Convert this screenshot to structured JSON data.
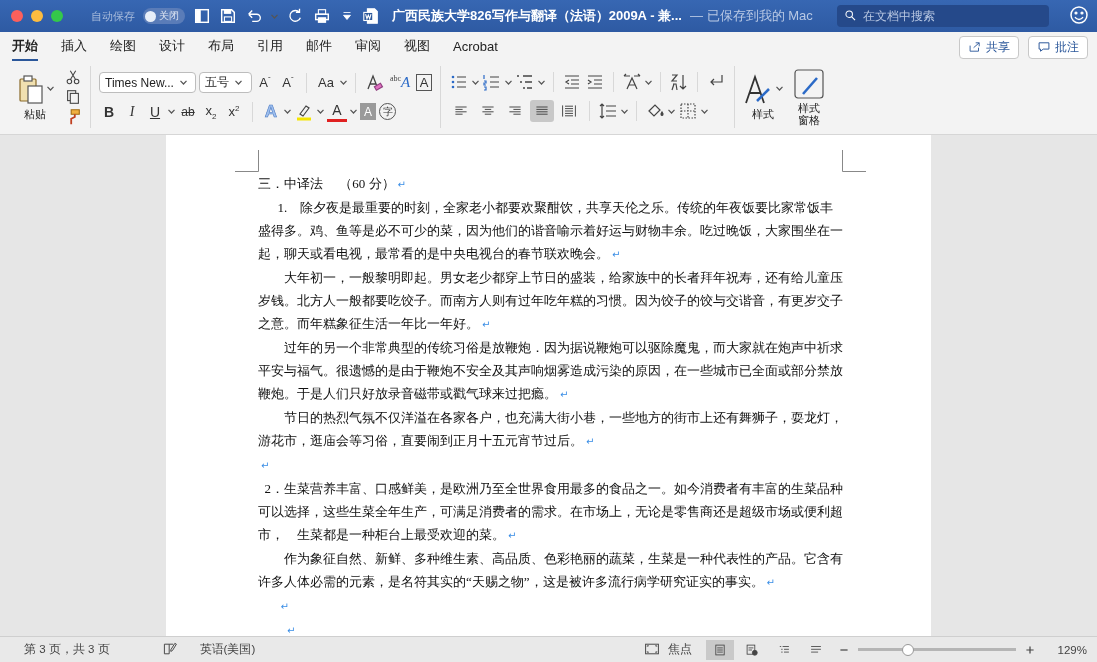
{
  "window": {
    "autosave_label": "自动保存",
    "autosave_toggle": {
      "label": "关闭",
      "on": false
    },
    "title": "广西民族大学826写作与翻译（法语）2009A  -  兼...",
    "save_status": "— 已保存到我的 Mac",
    "search": {
      "placeholder": "在文档中搜索"
    }
  },
  "tabs": [
    {
      "label": "开始",
      "selected": true
    },
    {
      "label": "插入",
      "selected": false
    },
    {
      "label": "绘图",
      "selected": false
    },
    {
      "label": "设计",
      "selected": false
    },
    {
      "label": "布局",
      "selected": false
    },
    {
      "label": "引用",
      "selected": false
    },
    {
      "label": "邮件",
      "selected": false
    },
    {
      "label": "审阅",
      "selected": false
    },
    {
      "label": "视图",
      "selected": false
    },
    {
      "label": "Acrobat",
      "selected": false
    }
  ],
  "share_button": "共享",
  "comments_button": "批注",
  "ribbon": {
    "paste_label": "粘贴",
    "font_name": "Times New...",
    "font_size": "五号",
    "font_top_glyphs": [
      "A$^{ˆ}$",
      "A$^{ˇ}$",
      "Aa",
      "$^{abc}$A",
      "A"
    ],
    "font_bottom_glyphs": [
      "B",
      "I",
      "U",
      "ab",
      "x$_{2}$",
      "x$^{2}$",
      "A",
      "A",
      "A",
      "字"
    ],
    "alignment": [
      {
        "selected": false
      },
      {
        "selected": false
      },
      {
        "selected": false
      },
      {
        "selected": true
      },
      {
        "selected": false
      }
    ],
    "styles_label": "样式",
    "styles_pane_label": "样式窗格"
  },
  "document": {
    "paragraphs": [
      {
        "kind": "heading",
        "text": "三．中译法　 （60 分）",
        "mark": "↵"
      },
      {
        "kind": "numbered",
        "text": "1.　除夕夜是最重要的时刻，全家老小都要欢聚酣饮，共享天伦之乐。传统的年夜饭要比家常饭丰盛得多。鸡、鱼等是必不可少的菜，因为他们的谐音喻示着好运与财物丰余。吃过晚饭，大家围坐在一起，聊天或看电视，最常看的是中央电视台的春节联欢晚会。",
        "mark": "↵"
      },
      {
        "kind": "body",
        "text": "大年初一，一般黎明即起。男女老少都穿上节日的盛装，给家族中的长者拜年祝寿，还有给儿童压岁钱。北方人一般都要吃饺子。而南方人则有过年吃年糕的习惯。因为饺子的饺与交谐音，有更岁交子之意。而年糕象征生活一年比一年好。",
        "mark": "↵"
      },
      {
        "kind": "body",
        "text": "过年的另一个非常典型的传统习俗是放鞭炮．因为据说鞭炮可以驱除魔鬼，而大家就在炮声中祈求平安与福气。很遗憾的是由于鞭炮不安全及其声响烟雾造成污染的原因，在一些城市已全面或部分禁放鞭炮。于是人们只好放录音磁带或戳气球来过把瘾。",
        "mark": "↵"
      },
      {
        "kind": "body",
        "text": "节日的热烈气氛不仅洋溢在各家各户，也充满大街小巷，一些地方的街市上还有舞狮子，耍龙灯，游花市，逛庙会等习俗，直要闹到正月十五元宵节过后。",
        "mark": "↵"
      },
      {
        "kind": "plain",
        "mark": "↵"
      },
      {
        "kind": "numbered2",
        "text": "2．生菜营养丰富、口感鲜美，是欧洲乃至全世界食用最多的食品之一。如今消费者有丰富的生菜品种可以选择，这些生菜全年生产，可满足消费者的需求。在市场上，无论是零售商还是超级市场或便利超市，　生菜都是一种柜台上最受欢迎的菜。",
        "mark": "↵"
      },
      {
        "kind": "body",
        "text": "作为象征自然、新鲜、多种维生素、高品质、色彩艳丽的蔬菜，生菜是一种代表性的产品。它含有许多人体必需的元素，是名符其实的“天赐之物”，这是被许多流行病学研究证实的事实。",
        "mark": "↵"
      },
      {
        "kind": "numbered",
        "mark": "↵"
      },
      {
        "kind": "body",
        "mark": "↵"
      }
    ]
  },
  "status_bar": {
    "page": "第 3 页，共 3 页",
    "language": "英语(美国)",
    "focus": "焦点",
    "views": [
      {
        "selected": true
      },
      {
        "selected": false
      },
      {
        "selected": false
      },
      {
        "selected": false
      }
    ],
    "zoom": {
      "level": 0.32,
      "reading": "129%"
    }
  }
}
